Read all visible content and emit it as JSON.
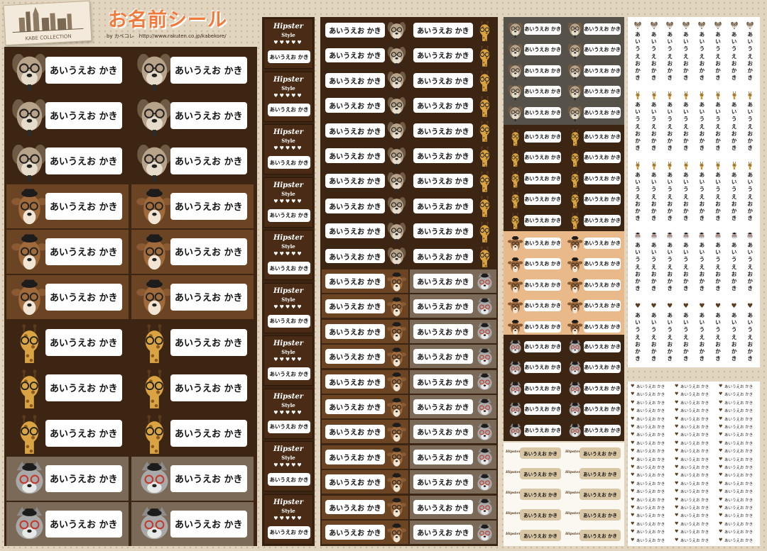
{
  "title": "お名前シール",
  "byline": "by カベコレ　http://www.rakuten.co.jp/kabekore/",
  "logo_text": "KABE COLLECTION",
  "sticker_name": "あいうえお かき",
  "hipster": "Hipster",
  "style": "Style",
  "colors": {
    "dark_brown": "#3d2513",
    "mid_brown": "#6b4423",
    "taupe": "#7c6a58",
    "peach": "#e9b98a",
    "grey_dark": "#575249",
    "title_orange": "#f07a3c"
  }
}
